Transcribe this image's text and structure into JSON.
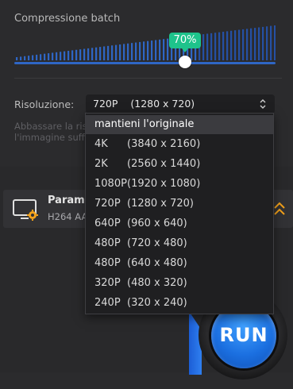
{
  "compression": {
    "title": "Compressione batch",
    "value_label": "70%",
    "level": 0.7
  },
  "resolution": {
    "label": "Risoluzione:",
    "selected_res": "720P",
    "selected_dim": "(1280 x 720)",
    "hint_line1": "Abbassare la riso",
    "hint_line2": "l'immagine suffic",
    "options": [
      {
        "res": "mantieni l'originale",
        "dim": ""
      },
      {
        "res": "4K",
        "dim": "(3840 x 2160)"
      },
      {
        "res": "2K",
        "dim": "(2560 x 1440)"
      },
      {
        "res": "1080P",
        "dim": "(1920 x 1080)"
      },
      {
        "res": "720P",
        "dim": "(1280 x 720)"
      },
      {
        "res": "640P",
        "dim": "(960 x 640)"
      },
      {
        "res": "480P",
        "dim": "(720 x 480)"
      },
      {
        "res": "480P",
        "dim": "(640 x 480)"
      },
      {
        "res": "320P",
        "dim": "(480 x 320)"
      },
      {
        "res": "240P",
        "dim": "(320 x 240)"
      }
    ]
  },
  "params": {
    "title": "Parame",
    "subtitle": "H264  AA"
  },
  "run": {
    "label": "RUN"
  },
  "colors": {
    "accent_blue": "#2f66c4",
    "badge_green": "#1ec38b",
    "icon_orange": "#f3a21b"
  }
}
